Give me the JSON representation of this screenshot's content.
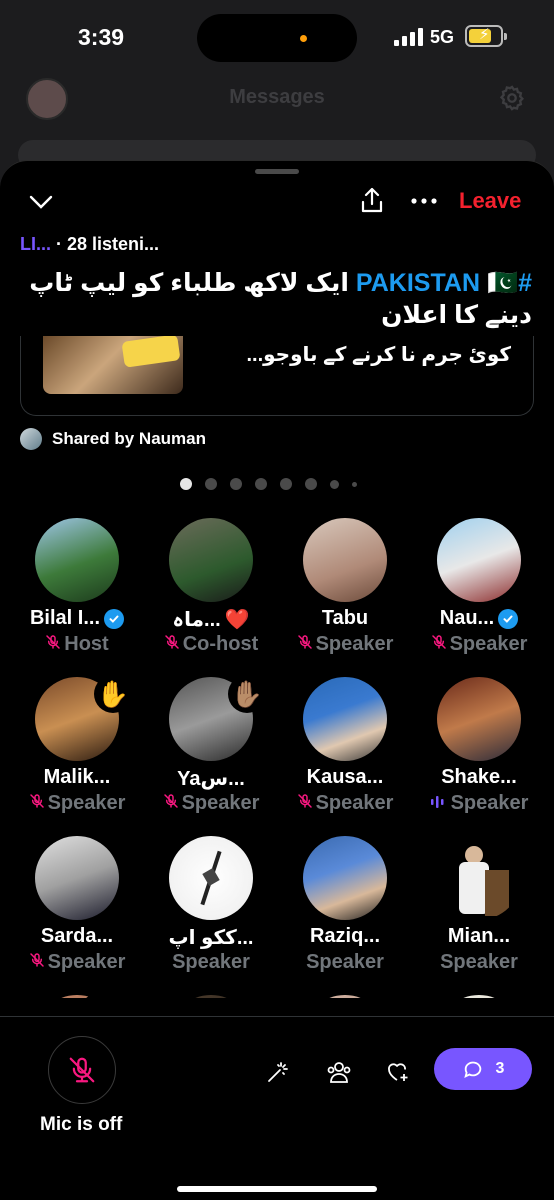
{
  "status_bar": {
    "time": "3:39",
    "network": "5G"
  },
  "underlay": {
    "title": "Messages"
  },
  "space": {
    "action_leave": "Leave",
    "room_tag": "LI...",
    "listeners": "· 28 listeni...",
    "title_hashtag": "#PAKISTAN",
    "title_flag": "🇵🇰",
    "title_text": "ایک لاکھ طلباء کو لیپ ٹاپ دینے کا اعلان",
    "card_text": "کوئ جرم نا کرنے کے باوجو...",
    "shared_by": "Shared by Nauman"
  },
  "participants": [
    {
      "name": "Bilal I...",
      "role": "Host",
      "verified": true,
      "hand": ""
    },
    {
      "name": "ماہ...",
      "emoji": "❤️",
      "role": "Co-host",
      "verified": false,
      "hand": ""
    },
    {
      "name": "Tabu",
      "role": "Speaker",
      "verified": false,
      "hand": ""
    },
    {
      "name": "Nau...",
      "role": "Speaker",
      "verified": true,
      "hand": ""
    },
    {
      "name": "Malik...",
      "role": "Speaker",
      "verified": false,
      "hand": "✋"
    },
    {
      "name": "Yaس...",
      "role": "Speaker",
      "verified": false,
      "hand": "✋🏽"
    },
    {
      "name": "Kausa...",
      "role": "Speaker",
      "verified": false,
      "hand": ""
    },
    {
      "name": "Shake...",
      "role": "Speaker",
      "verified": false,
      "hand": "",
      "speaking": true
    },
    {
      "name": "Sarda...",
      "role": "Speaker",
      "verified": false,
      "hand": ""
    },
    {
      "name": "ککو اپ...",
      "role": "Speaker",
      "verified": false,
      "hand": "",
      "unmuted": true
    },
    {
      "name": "Raziq...",
      "role": "Speaker",
      "verified": false,
      "hand": "",
      "unmuted": true
    },
    {
      "name": "Mian...",
      "role": "Speaker",
      "verified": false,
      "hand": "",
      "unmuted": true
    }
  ],
  "next_row_hand": "🤨",
  "controls": {
    "mic_label": "Mic is off",
    "comments_count": "3"
  },
  "colors": {
    "accent": "#7856ff",
    "leave": "#f4212e",
    "verified": "#1d9bf0",
    "mic_off": "#f91880"
  }
}
